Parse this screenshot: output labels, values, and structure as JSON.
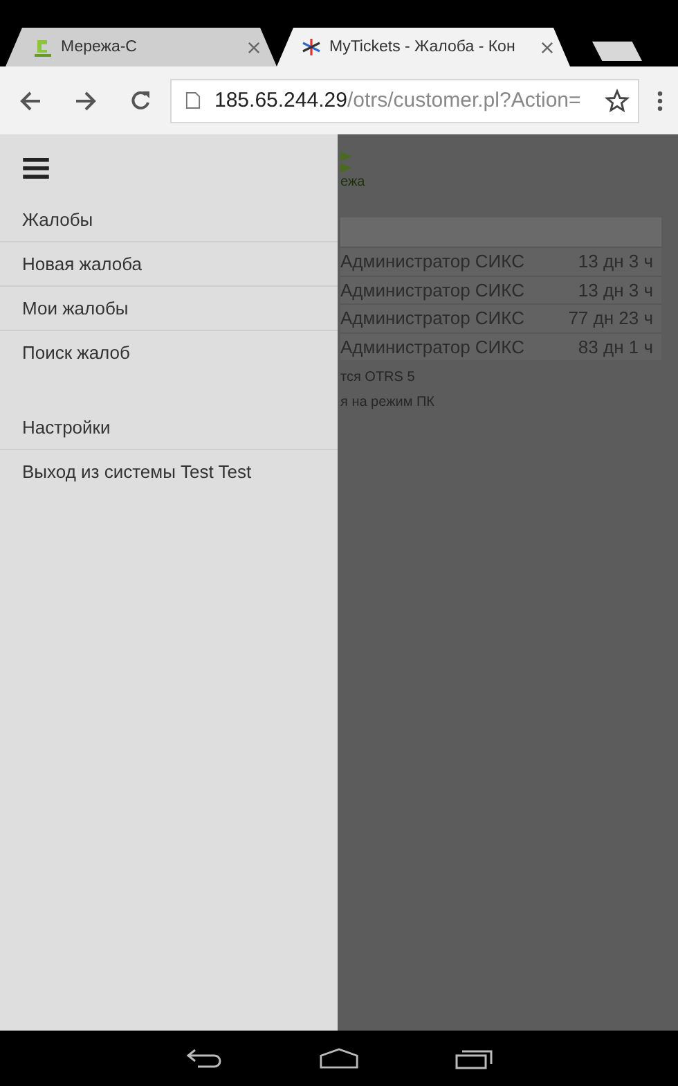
{
  "tabs": [
    {
      "title": "Мережа-С",
      "selected": false
    },
    {
      "title": "MyTickets - Жалоба - Кон",
      "selected": true
    }
  ],
  "address_bar": {
    "host": "185.65.244.29",
    "path": "/otrs/customer.pl?Action="
  },
  "page": {
    "logo_text": "ежа",
    "table_rows": [
      {
        "owner": "Администратор СИКС",
        "age": "13 дн 3 ч"
      },
      {
        "owner": "Администратор СИКС",
        "age": "13 дн 3 ч"
      },
      {
        "owner": "Администратор СИКС",
        "age": "77 дн 23 ч"
      },
      {
        "owner": "Администратор СИКС",
        "age": "83 дн 1 ч"
      }
    ],
    "footer_lines": [
      "тся OTRS 5",
      "я на режим ПК"
    ]
  },
  "drawer": {
    "sections": [
      [
        "Жалобы",
        "Новая жалоба",
        "Мои жалобы",
        "Поиск жалоб"
      ],
      [
        "Настройки",
        "Выход из системы Test Test"
      ]
    ]
  }
}
